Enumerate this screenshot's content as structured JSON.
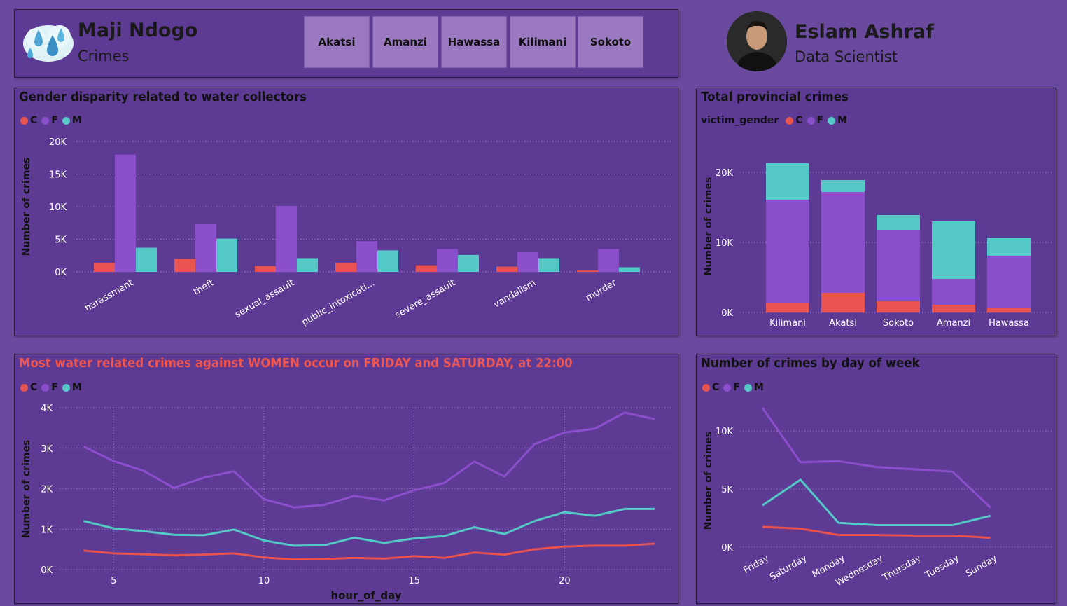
{
  "header": {
    "brand_title": "Maji Ndogo",
    "brand_subtitle": "Crimes",
    "slicers": [
      "Akatsi",
      "Amanzi",
      "Hawassa",
      "Kilimani",
      "Sokoto"
    ],
    "profile_name": "Eslam Ashraf",
    "profile_role": "Data Scientist"
  },
  "colors": {
    "C": "#e8534f",
    "F": "#8b4fcb",
    "M": "#54c9c6",
    "title_alert": "#f0554f"
  },
  "legend": {
    "series": [
      "C",
      "F",
      "M"
    ],
    "victim_gender_title": "victim_gender"
  },
  "chart_data": [
    {
      "id": "gender_disparity",
      "type": "bar",
      "title": "Gender disparity related to water collectors",
      "ylabel": "Number of crimes",
      "ylim": [
        0,
        20000
      ],
      "yticks": [
        "0K",
        "5K",
        "10K",
        "15K",
        "20K"
      ],
      "categories": [
        "harassment",
        "theft",
        "sexual_assault",
        "public_intoxicati...",
        "severe_assault",
        "vandalism",
        "murder"
      ],
      "series": [
        {
          "name": "C",
          "values": [
            1400,
            2000,
            900,
            1400,
            1000,
            800,
            200
          ]
        },
        {
          "name": "F",
          "values": [
            18000,
            7300,
            10100,
            4700,
            3500,
            3000,
            3500
          ]
        },
        {
          "name": "M",
          "values": [
            3700,
            5100,
            2100,
            3300,
            2600,
            2100,
            700
          ]
        }
      ]
    },
    {
      "id": "provincial",
      "type": "bar",
      "stacked": true,
      "title": "Total provincial crimes",
      "ylabel": "Number of crimes",
      "ylim": [
        0,
        22000
      ],
      "yticks": [
        "0K",
        "10K",
        "20K"
      ],
      "categories": [
        "Kilimani",
        "Akatsi",
        "Sokoto",
        "Amanzi",
        "Hawassa"
      ],
      "series": [
        {
          "name": "C",
          "values": [
            1400,
            2800,
            1600,
            1100,
            600
          ]
        },
        {
          "name": "F",
          "values": [
            14700,
            14400,
            10200,
            3700,
            7500
          ]
        },
        {
          "name": "M",
          "values": [
            5200,
            1700,
            2100,
            8200,
            2500
          ]
        }
      ]
    },
    {
      "id": "hourly",
      "type": "line",
      "title": "Most water related crimes against WOMEN occur on FRIDAY and SATURDAY, at 22:00",
      "xlabel": "hour_of_day",
      "ylabel": "Number of crimes",
      "ylim": [
        0,
        4000
      ],
      "xlim": [
        3.2,
        23.6
      ],
      "yticks": [
        "0K",
        "1K",
        "2K",
        "3K",
        "4K"
      ],
      "xticks": [
        5,
        10,
        15,
        20
      ],
      "x": [
        4,
        5,
        6,
        7,
        8,
        9,
        10,
        11,
        12,
        13,
        14,
        15,
        16,
        17,
        18,
        19,
        20,
        21,
        22,
        23
      ],
      "series": [
        {
          "name": "C",
          "values": [
            470,
            400,
            380,
            350,
            370,
            400,
            300,
            250,
            260,
            290,
            270,
            330,
            290,
            420,
            370,
            500,
            570,
            590,
            590,
            640
          ]
        },
        {
          "name": "F",
          "values": [
            3040,
            2680,
            2440,
            2020,
            2270,
            2430,
            1740,
            1540,
            1600,
            1820,
            1710,
            1960,
            2140,
            2670,
            2300,
            3100,
            3390,
            3480,
            3880,
            3720
          ]
        },
        {
          "name": "M",
          "values": [
            1200,
            1020,
            950,
            860,
            850,
            990,
            720,
            590,
            600,
            790,
            660,
            770,
            830,
            1050,
            880,
            1200,
            1420,
            1330,
            1500,
            1500
          ]
        }
      ]
    },
    {
      "id": "weekday",
      "type": "line",
      "title": "Number of crimes by day of week",
      "ylabel": "Number of crimes",
      "ylim": [
        0,
        12000
      ],
      "yticks": [
        "0K",
        "5K",
        "10K"
      ],
      "categories": [
        "Friday",
        "Saturday",
        "Monday",
        "Wednesday",
        "Thursday",
        "Tuesday",
        "Sunday"
      ],
      "series": [
        {
          "name": "C",
          "values": [
            1750,
            1600,
            1050,
            1050,
            1000,
            1000,
            800
          ]
        },
        {
          "name": "F",
          "values": [
            12000,
            7300,
            7400,
            6900,
            6700,
            6500,
            3400
          ]
        },
        {
          "name": "M",
          "values": [
            3600,
            5800,
            2100,
            1900,
            1900,
            1900,
            2700
          ]
        }
      ]
    }
  ]
}
